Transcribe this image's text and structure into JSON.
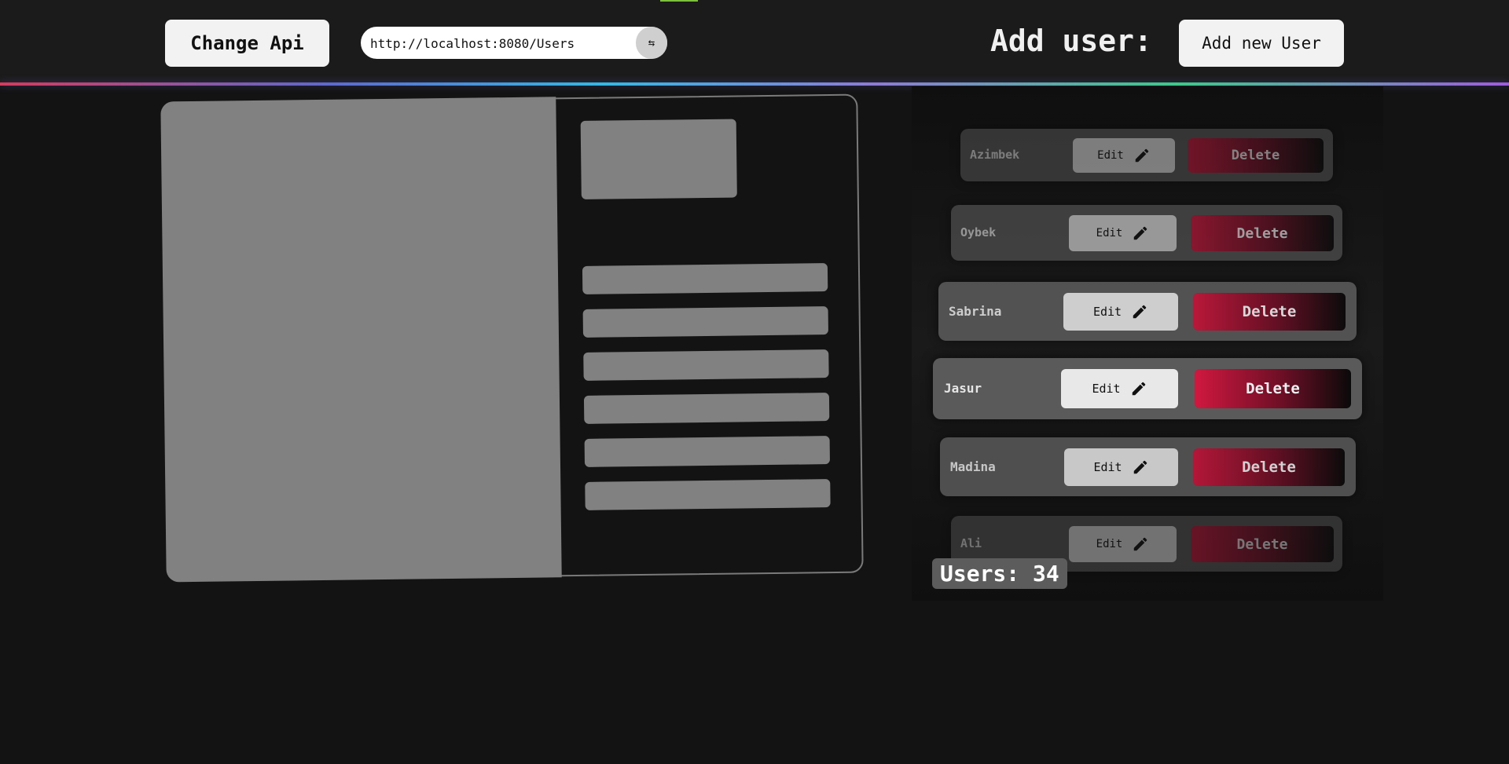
{
  "header": {
    "change_api_label": "Change Api",
    "api_url": "http://localhost:8080/Users",
    "swap_icon": "⇆",
    "add_user_label": "Add user:",
    "add_new_user_label": "Add new User"
  },
  "users": {
    "count_label": "Users: 34",
    "rows": [
      {
        "name": "Azimbek",
        "edit_label": "Edit",
        "delete_label": "Delete"
      },
      {
        "name": "Oybek",
        "edit_label": "Edit",
        "delete_label": "Delete"
      },
      {
        "name": "Sabrina",
        "edit_label": "Edit",
        "delete_label": "Delete"
      },
      {
        "name": "Jasur",
        "edit_label": "Edit",
        "delete_label": "Delete"
      },
      {
        "name": "Madina",
        "edit_label": "Edit",
        "delete_label": "Delete"
      },
      {
        "name": "Ali",
        "edit_label": "Edit",
        "delete_label": "Delete"
      }
    ]
  },
  "colors": {
    "background": "#131313",
    "header": "#1b1b1b",
    "placeholder_gray": "#818181",
    "delete_red": "#d0183f"
  },
  "icons": [
    "swap-arrows-icon",
    "pencil-icon"
  ]
}
